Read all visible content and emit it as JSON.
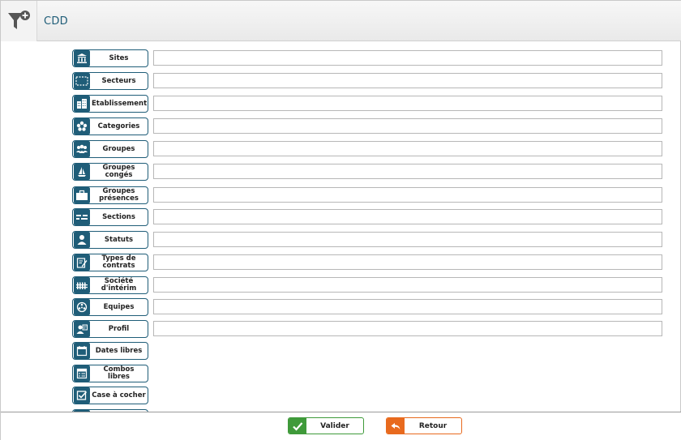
{
  "header": {
    "title": "CDD",
    "filter_icon": "filter-add-icon"
  },
  "criteria": [
    {
      "label": "Sites",
      "icon": "bank-icon",
      "has_field": true
    },
    {
      "label": "Secteurs",
      "icon": "dashed-square-icon",
      "has_field": true
    },
    {
      "label": "Etablissement",
      "icon": "buildings-icon",
      "has_field": true
    },
    {
      "label": "Categories",
      "icon": "flower-icon",
      "has_field": true
    },
    {
      "label": "Groupes",
      "icon": "users-icon",
      "has_field": true
    },
    {
      "label": "Groupes congés",
      "icon": "sailboat-icon",
      "has_field": true
    },
    {
      "label": "Groupes présences",
      "icon": "briefcase-icon",
      "has_field": true
    },
    {
      "label": "Sections",
      "icon": "sections-icon",
      "has_field": true
    },
    {
      "label": "Statuts",
      "icon": "person-icon",
      "has_field": true
    },
    {
      "label": "Types de contrats",
      "icon": "contract-edit-icon",
      "has_field": true
    },
    {
      "label": "Société d'intérim",
      "icon": "fence-icon",
      "has_field": true
    },
    {
      "label": "Equipes",
      "icon": "team-circle-icon",
      "has_field": true
    },
    {
      "label": "Profil",
      "icon": "profile-icon",
      "has_field": true
    },
    {
      "label": "Dates libres",
      "icon": "calendar-icon",
      "has_field": false
    },
    {
      "label": "Combos libres",
      "icon": "combo-icon",
      "has_field": false
    },
    {
      "label": "Case à cocher",
      "icon": "checkbox-icon",
      "has_field": false
    }
  ],
  "footer": {
    "valider_label": "Valider",
    "valider_icon": "check-icon",
    "retour_label": "Retour",
    "retour_icon": "return-arrow-icon"
  },
  "colors": {
    "accent": "#1f5d78",
    "valider": "#3f9a3a",
    "retour": "#e86a1e"
  }
}
